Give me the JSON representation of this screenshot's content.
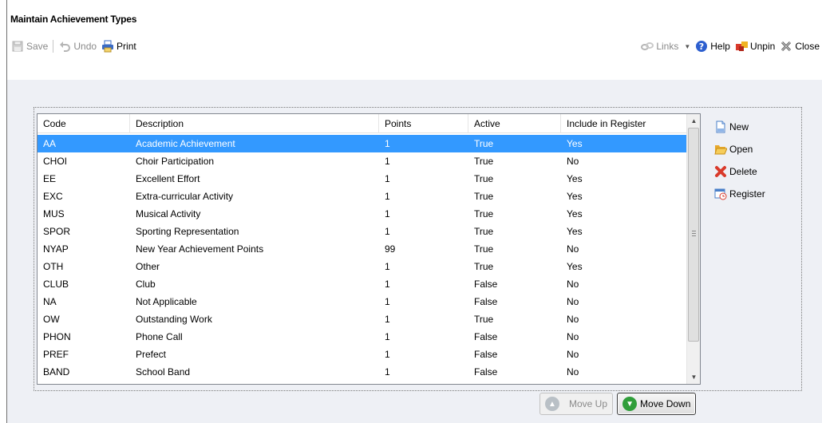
{
  "window": {
    "title": "Maintain Achievement Types"
  },
  "toolbar": {
    "save_label": "Save",
    "undo_label": "Undo",
    "print_label": "Print",
    "links_label": "Links",
    "help_label": "Help",
    "unpin_label": "Unpin",
    "close_label": "Close"
  },
  "table": {
    "columns": [
      "Code",
      "Description",
      "Points",
      "Active",
      "Include in Register"
    ],
    "rows": [
      [
        "AA",
        "Academic Achievement",
        "1",
        "True",
        "Yes"
      ],
      [
        "CHOI",
        "Choir Participation",
        "1",
        "True",
        "No"
      ],
      [
        "EE",
        "Excellent Effort",
        "1",
        "True",
        "Yes"
      ],
      [
        "EXC",
        "Extra-curricular Activity",
        "1",
        "True",
        "Yes"
      ],
      [
        "MUS",
        "Musical Activity",
        "1",
        "True",
        "Yes"
      ],
      [
        "SPOR",
        "Sporting Representation",
        "1",
        "True",
        "Yes"
      ],
      [
        "NYAP",
        "New Year Achievement Points",
        "99",
        "True",
        "No"
      ],
      [
        "OTH",
        "Other",
        "1",
        "True",
        "Yes"
      ],
      [
        "CLUB",
        "Club",
        "1",
        "False",
        "No"
      ],
      [
        "NA",
        "Not Applicable",
        "1",
        "False",
        "No"
      ],
      [
        "OW",
        "Outstanding Work",
        "1",
        "True",
        "No"
      ],
      [
        "PHON",
        "Phone Call",
        "1",
        "False",
        "No"
      ],
      [
        "PREF",
        "Prefect",
        "1",
        "False",
        "No"
      ],
      [
        "BAND",
        "School Band",
        "1",
        "False",
        "No"
      ]
    ],
    "selected_row": 0
  },
  "side_actions": {
    "new_label": "New",
    "open_label": "Open",
    "delete_label": "Delete",
    "register_label": "Register"
  },
  "move": {
    "up_label": "Move Up",
    "down_label": "Move Down"
  },
  "colors": {
    "selection": "#3399ff",
    "help_blue": "#2d5fcf",
    "delete_red": "#d93a2b",
    "move_green": "#2f9e3a"
  }
}
